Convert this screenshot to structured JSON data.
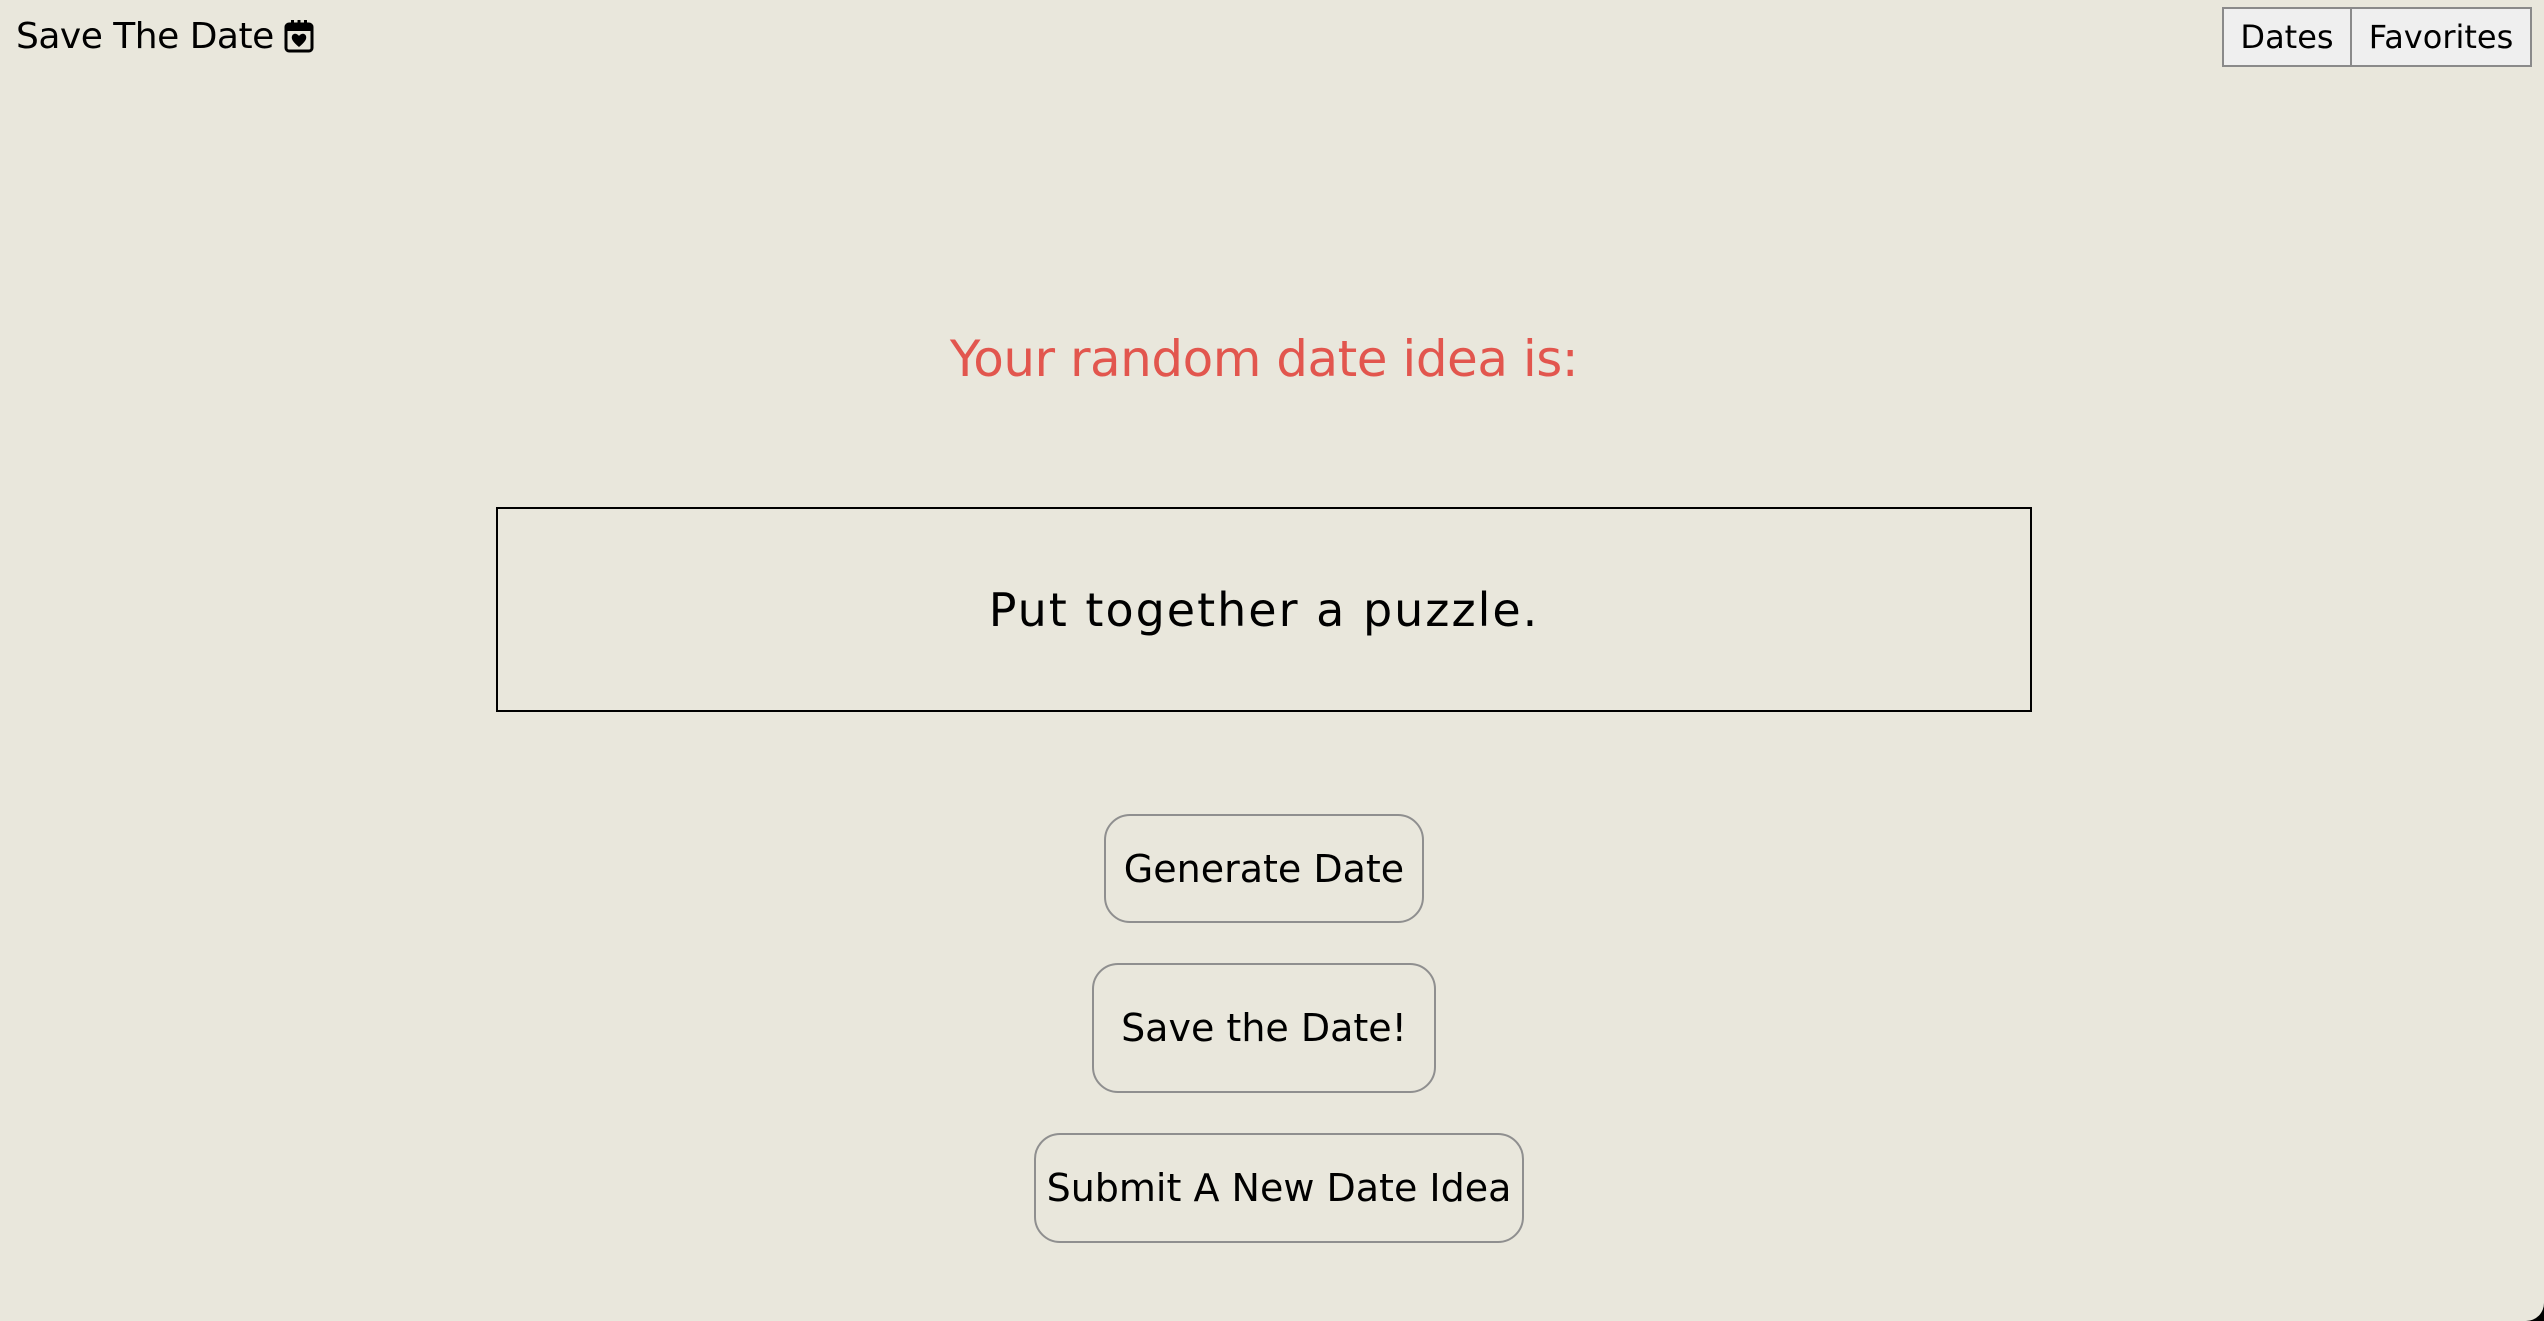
{
  "header": {
    "brand_title": "Save The Date",
    "brand_icon": "calendar-heart-icon",
    "nav": {
      "dates_label": "Dates",
      "favorites_label": "Favorites"
    }
  },
  "main": {
    "headline": "Your random date idea is:",
    "idea": "Put together a puzzle.",
    "buttons": {
      "generate_label": "Generate Date",
      "save_label": "Save the Date!",
      "submit_label": "Submit A New Date Idea"
    }
  },
  "colors": {
    "background": "#e9e7dc",
    "headline": "#e2564e"
  }
}
